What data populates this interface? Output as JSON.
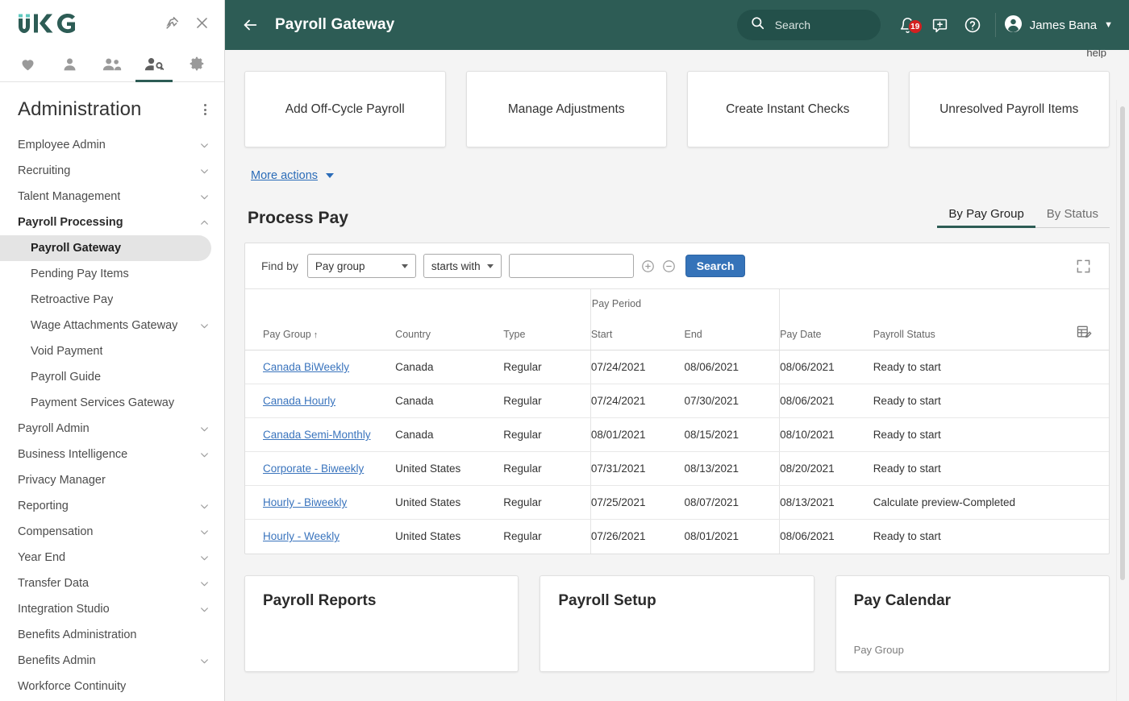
{
  "sidebar": {
    "logo": "UKG",
    "pin_icon": "pin-icon",
    "close_icon": "close-icon",
    "icon_tabs": [
      {
        "name": "heart-icon",
        "active": false
      },
      {
        "name": "person-icon",
        "active": false
      },
      {
        "name": "people-icon",
        "active": false
      },
      {
        "name": "person-key-icon",
        "active": true
      },
      {
        "name": "gear-icon",
        "active": false
      }
    ],
    "title": "Administration",
    "items": [
      {
        "label": "Employee Admin",
        "level": 1,
        "expandable": true,
        "expanded": false,
        "selected": false
      },
      {
        "label": "Recruiting",
        "level": 1,
        "expandable": true,
        "expanded": false,
        "selected": false
      },
      {
        "label": "Talent Management",
        "level": 1,
        "expandable": true,
        "expanded": false,
        "selected": false
      },
      {
        "label": "Payroll Processing",
        "level": 1,
        "expandable": true,
        "expanded": true,
        "selected": false,
        "bold": true
      },
      {
        "label": "Payroll Gateway",
        "level": 2,
        "expandable": false,
        "selected": true
      },
      {
        "label": "Pending Pay Items",
        "level": 2,
        "expandable": false,
        "selected": false
      },
      {
        "label": "Retroactive Pay",
        "level": 2,
        "expandable": false,
        "selected": false
      },
      {
        "label": "Wage Attachments Gateway",
        "level": 2,
        "expandable": true,
        "expanded": false,
        "selected": false
      },
      {
        "label": "Void Payment",
        "level": 2,
        "expandable": false,
        "selected": false
      },
      {
        "label": "Payroll Guide",
        "level": 2,
        "expandable": false,
        "selected": false
      },
      {
        "label": "Payment Services Gateway",
        "level": 2,
        "expandable": false,
        "selected": false
      },
      {
        "label": "Payroll Admin",
        "level": 1,
        "expandable": true,
        "expanded": false,
        "selected": false
      },
      {
        "label": "Business Intelligence",
        "level": 1,
        "expandable": true,
        "expanded": false,
        "selected": false
      },
      {
        "label": "Privacy Manager",
        "level": 1,
        "expandable": false,
        "selected": false
      },
      {
        "label": "Reporting",
        "level": 1,
        "expandable": true,
        "expanded": false,
        "selected": false
      },
      {
        "label": "Compensation",
        "level": 1,
        "expandable": true,
        "expanded": false,
        "selected": false
      },
      {
        "label": "Year End",
        "level": 1,
        "expandable": true,
        "expanded": false,
        "selected": false
      },
      {
        "label": "Transfer Data",
        "level": 1,
        "expandable": true,
        "expanded": false,
        "selected": false
      },
      {
        "label": "Integration Studio",
        "level": 1,
        "expandable": true,
        "expanded": false,
        "selected": false
      },
      {
        "label": "Benefits Administration",
        "level": 1,
        "expandable": false,
        "selected": false
      },
      {
        "label": "Benefits Admin",
        "level": 1,
        "expandable": true,
        "expanded": false,
        "selected": false
      },
      {
        "label": "Workforce Continuity",
        "level": 1,
        "expandable": false,
        "selected": false
      }
    ]
  },
  "header": {
    "back_icon": "back-arrow-icon",
    "title": "Payroll Gateway",
    "search_placeholder": "Search",
    "search_icon": "search-icon",
    "notifications_icon": "bell-icon",
    "notifications_count": "19",
    "feedback_icon": "feedback-icon",
    "help_icon": "help-icon",
    "user_name": "James Bana",
    "avatar_icon": "avatar-icon",
    "brand_color": "#2d5c55"
  },
  "content": {
    "help_link": "help",
    "action_cards": [
      {
        "label": "Add Off-Cycle Payroll"
      },
      {
        "label": "Manage Adjustments"
      },
      {
        "label": "Create Instant Checks"
      },
      {
        "label": "Unresolved Payroll Items"
      }
    ],
    "more_actions": "More actions",
    "section_title": "Process Pay",
    "tabs": [
      {
        "label": "By Pay Group",
        "active": true
      },
      {
        "label": "By Status",
        "active": false
      }
    ],
    "findbar": {
      "label": "Find by",
      "field_value": "Pay group",
      "operator_value": "starts with",
      "term_value": "",
      "term_placeholder": "",
      "add_icon": "plus-circle-icon",
      "remove_icon": "minus-circle-icon",
      "search_button": "Search",
      "expand_icon": "expand-icon"
    },
    "table": {
      "group_header": "Pay Period",
      "settings_icon": "table-settings-icon",
      "columns": [
        {
          "label": "Pay Group",
          "sorted": "asc"
        },
        {
          "label": "Country"
        },
        {
          "label": "Type"
        },
        {
          "label": "Start"
        },
        {
          "label": "End"
        },
        {
          "label": "Pay Date"
        },
        {
          "label": "Payroll Status"
        }
      ],
      "rows": [
        {
          "pay_group": "Canada BiWeekly",
          "country": "Canada",
          "type": "Regular",
          "start": "07/24/2021",
          "end": "08/06/2021",
          "pay_date": "08/06/2021",
          "status": "Ready to start"
        },
        {
          "pay_group": "Canada Hourly",
          "country": "Canada",
          "type": "Regular",
          "start": "07/24/2021",
          "end": "07/30/2021",
          "pay_date": "08/06/2021",
          "status": "Ready to start"
        },
        {
          "pay_group": "Canada Semi-Monthly",
          "country": "Canada",
          "type": "Regular",
          "start": "08/01/2021",
          "end": "08/15/2021",
          "pay_date": "08/10/2021",
          "status": "Ready to start"
        },
        {
          "pay_group": "Corporate - Biweekly",
          "country": "United States",
          "type": "Regular",
          "start": "07/31/2021",
          "end": "08/13/2021",
          "pay_date": "08/20/2021",
          "status": "Ready to start"
        },
        {
          "pay_group": "Hourly - Biweekly",
          "country": "United States",
          "type": "Regular",
          "start": "07/25/2021",
          "end": "08/07/2021",
          "pay_date": "08/13/2021",
          "status": "Calculate preview-Completed"
        },
        {
          "pay_group": "Hourly - Weekly",
          "country": "United States",
          "type": "Regular",
          "start": "07/26/2021",
          "end": "08/01/2021",
          "pay_date": "08/06/2021",
          "status": "Ready to start"
        }
      ]
    },
    "bottom_cards": [
      {
        "title": "Payroll Reports",
        "subtitle": ""
      },
      {
        "title": "Payroll Setup",
        "subtitle": ""
      },
      {
        "title": "Pay Calendar",
        "subtitle": "Pay Group"
      }
    ]
  }
}
